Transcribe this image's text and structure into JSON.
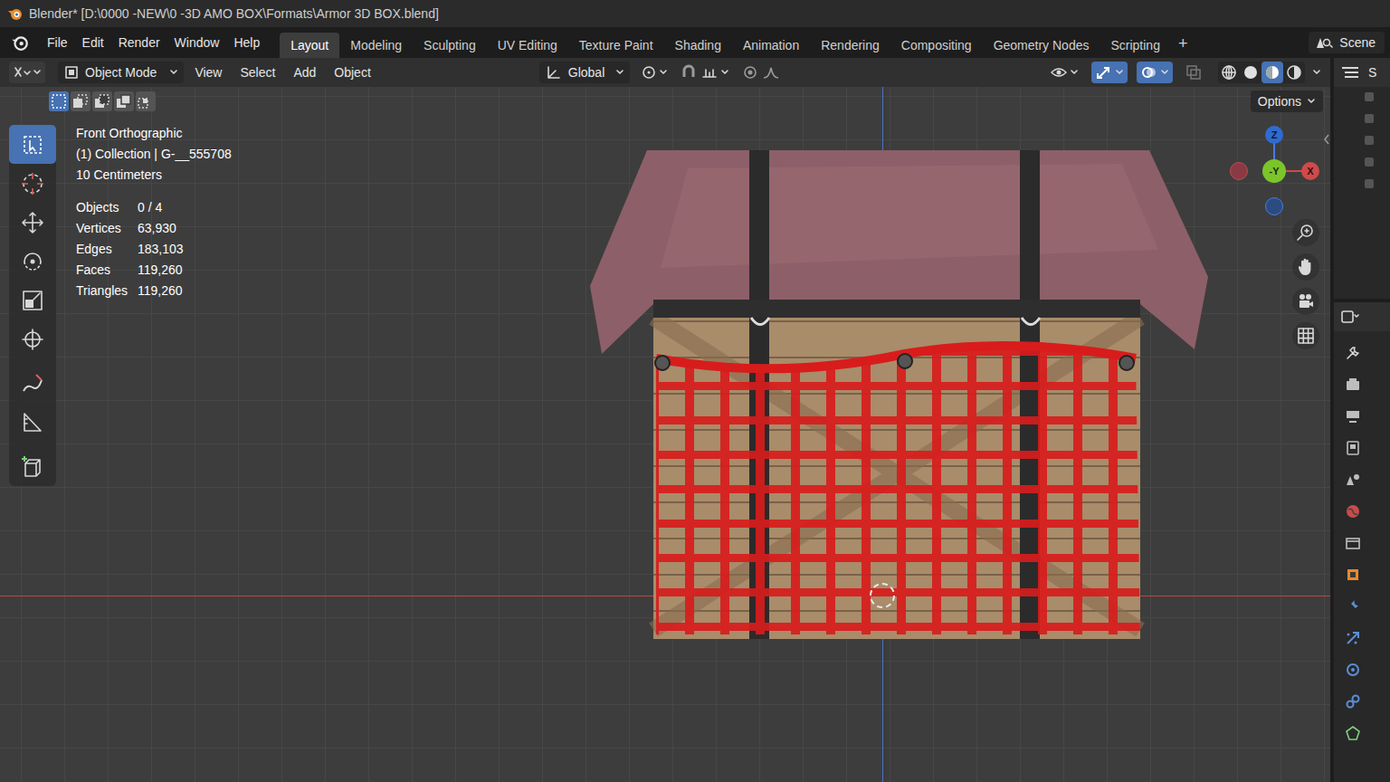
{
  "window": {
    "title": "Blender* [D:\\0000 -NEW\\0 -3D AMO BOX\\Formats\\Armor 3D BOX.blend]"
  },
  "menu": [
    "File",
    "Edit",
    "Render",
    "Window",
    "Help"
  ],
  "workspaces": [
    {
      "label": "Layout",
      "selected": true
    },
    {
      "label": "Modeling",
      "selected": false
    },
    {
      "label": "Sculpting",
      "selected": false
    },
    {
      "label": "UV Editing",
      "selected": false
    },
    {
      "label": "Texture Paint",
      "selected": false
    },
    {
      "label": "Shading",
      "selected": false
    },
    {
      "label": "Animation",
      "selected": false
    },
    {
      "label": "Rendering",
      "selected": false
    },
    {
      "label": "Compositing",
      "selected": false
    },
    {
      "label": "Geometry Nodes",
      "selected": false
    },
    {
      "label": "Scripting",
      "selected": false
    }
  ],
  "add_workspace": "+",
  "scene": "Scene",
  "header": {
    "mode": "Object Mode",
    "menus": [
      "View",
      "Select",
      "Add",
      "Object"
    ],
    "orientation": "Global",
    "toggles": [
      {
        "kind": "visibility",
        "on": false
      },
      {
        "kind": "gizmos",
        "on": true
      },
      {
        "kind": "overlays",
        "on": true
      },
      {
        "kind": "xray",
        "on": false
      }
    ],
    "shading": [
      {
        "kind": "wireframe",
        "selected": false
      },
      {
        "kind": "solid",
        "selected": false
      },
      {
        "kind": "material",
        "selected": true
      },
      {
        "kind": "rendered",
        "selected": false
      }
    ]
  },
  "select_modes": [
    {
      "kind": "set",
      "selected": true
    },
    {
      "kind": "extend",
      "selected": false
    },
    {
      "kind": "subtract",
      "selected": false
    },
    {
      "kind": "invert",
      "selected": false
    },
    {
      "kind": "intersect",
      "selected": false
    }
  ],
  "tools": [
    {
      "kind": "select",
      "selected": true
    },
    {
      "kind": "cursor",
      "selected": false
    },
    {
      "kind": "move",
      "selected": false
    },
    {
      "kind": "rotate",
      "selected": false
    },
    {
      "kind": "scale",
      "selected": false
    },
    {
      "kind": "transform",
      "selected": false
    },
    {
      "kind": "annotate",
      "selected": false
    },
    {
      "kind": "measure",
      "selected": false
    },
    {
      "kind": "addcube",
      "selected": false
    }
  ],
  "viewport": {
    "view": "Front Orthographic",
    "collection": "(1) Collection | G-__555708",
    "scale": "10 Centimeters",
    "stats": [
      {
        "label": "Objects",
        "value": "0 / 4"
      },
      {
        "label": "Vertices",
        "value": "63,930"
      },
      {
        "label": "Edges",
        "value": "183,103"
      },
      {
        "label": "Faces",
        "value": "119,260"
      },
      {
        "label": "Triangles",
        "value": "119,260"
      }
    ],
    "options": "Options"
  },
  "gizmo": {
    "z": "Z",
    "y": "-Y",
    "x": "X"
  },
  "outliner": {
    "label": "S"
  },
  "properties_tabs": [
    {
      "kind": "tool"
    },
    {
      "kind": "render"
    },
    {
      "kind": "output"
    },
    {
      "kind": "viewlayer"
    },
    {
      "kind": "scene"
    },
    {
      "kind": "world"
    },
    {
      "kind": "collection"
    },
    {
      "kind": "object"
    },
    {
      "kind": "modifiers"
    },
    {
      "kind": "particles"
    },
    {
      "kind": "physics"
    },
    {
      "kind": "constraints"
    },
    {
      "kind": "data"
    }
  ]
}
